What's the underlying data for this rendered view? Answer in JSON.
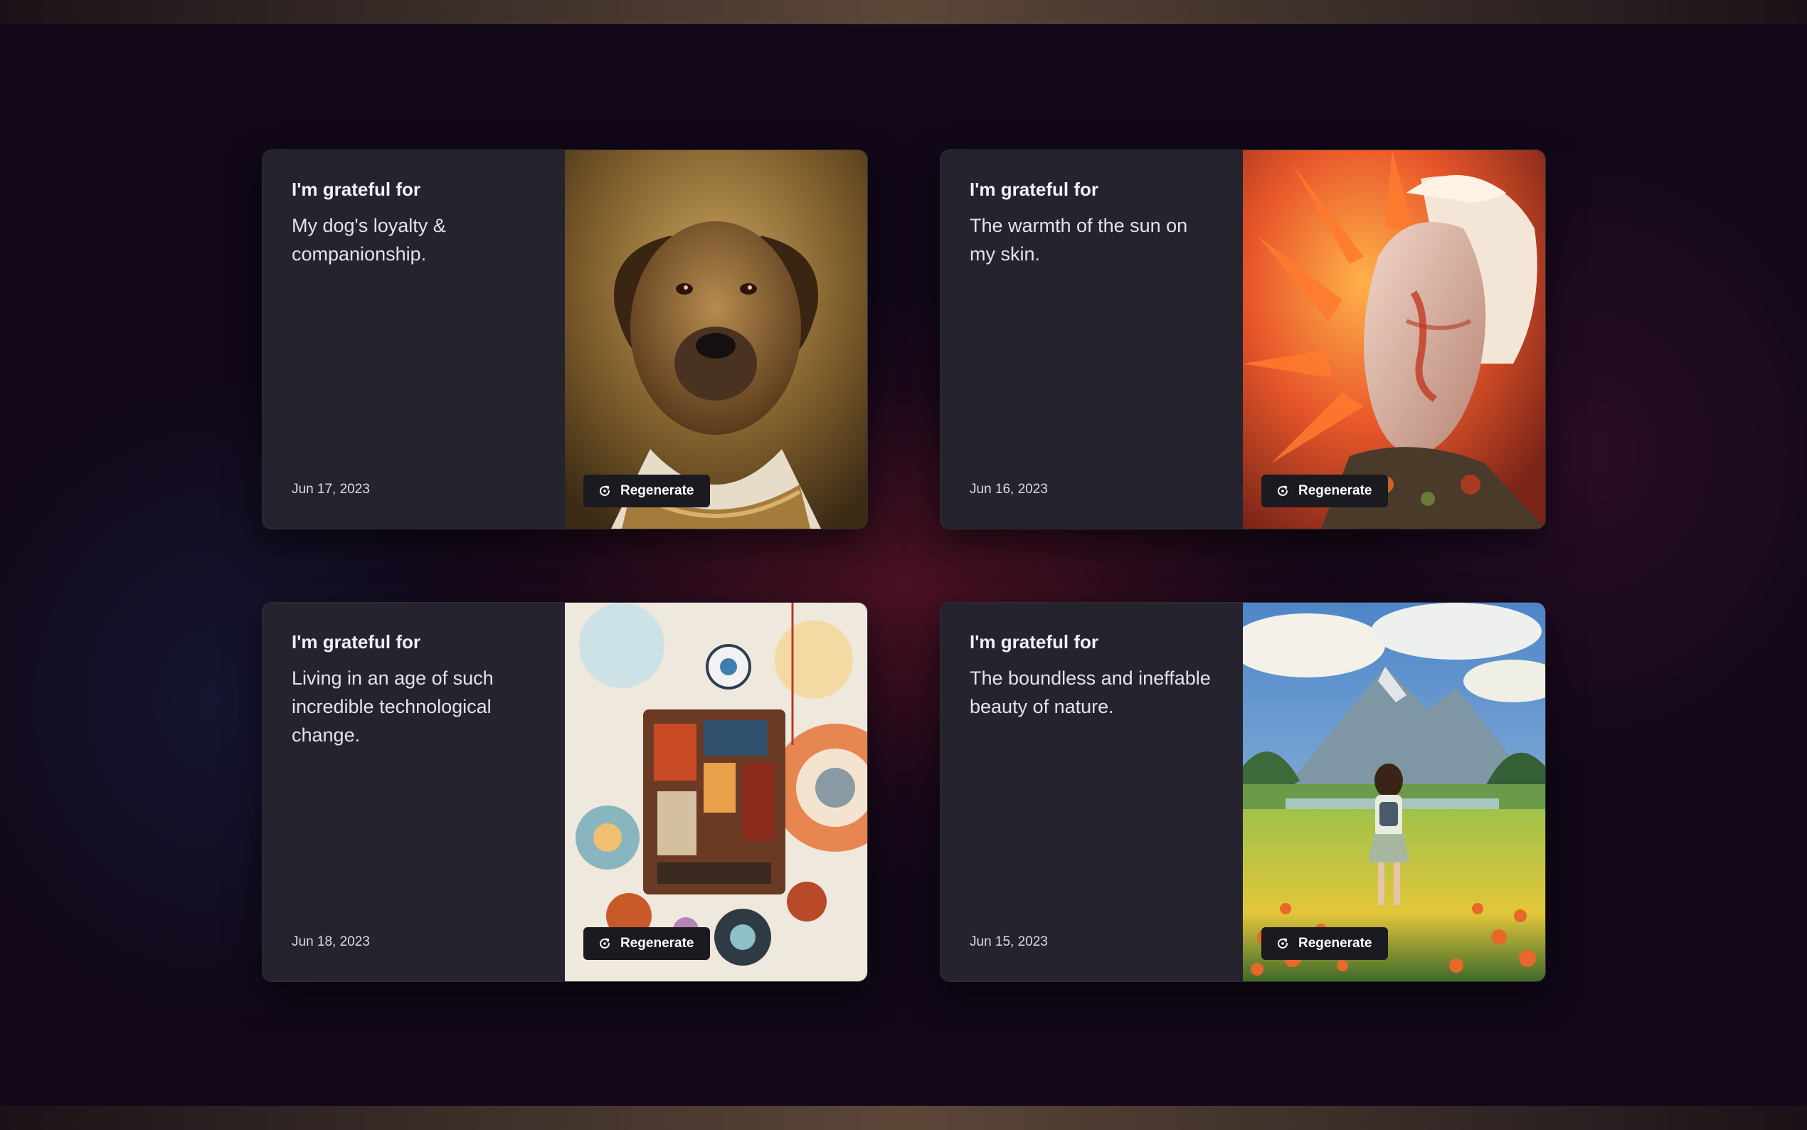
{
  "cards": [
    {
      "heading": "I'm grateful for",
      "body": "My dog's loyalty & companionship.",
      "date": "Jun 17, 2023",
      "image": "dog-portrait-image",
      "button_label": "Regenerate",
      "button_icon": "regenerate-icon"
    },
    {
      "heading": "I'm grateful for",
      "body": "The warmth of the sun on my skin.",
      "date": "Jun 16, 2023",
      "image": "sun-face-portrait-image",
      "button_label": "Regenerate",
      "button_icon": "regenerate-icon"
    },
    {
      "heading": "I'm grateful for",
      "body": "Living in an age of such incredible technological change.",
      "date": "Jun 18, 2023",
      "image": "abstract-technology-collage-image",
      "button_label": "Regenerate",
      "button_icon": "regenerate-icon"
    },
    {
      "heading": "I'm grateful for",
      "body": "The boundless and ineffable beauty of nature.",
      "date": "Jun 15, 2023",
      "image": "nature-landscape-girl-image",
      "button_label": "Regenerate",
      "button_icon": "regenerate-icon"
    }
  ],
  "colors": {
    "background": "#120819",
    "card": "#25232d",
    "button": "#1b1a20",
    "text": "#f2f0f5"
  }
}
